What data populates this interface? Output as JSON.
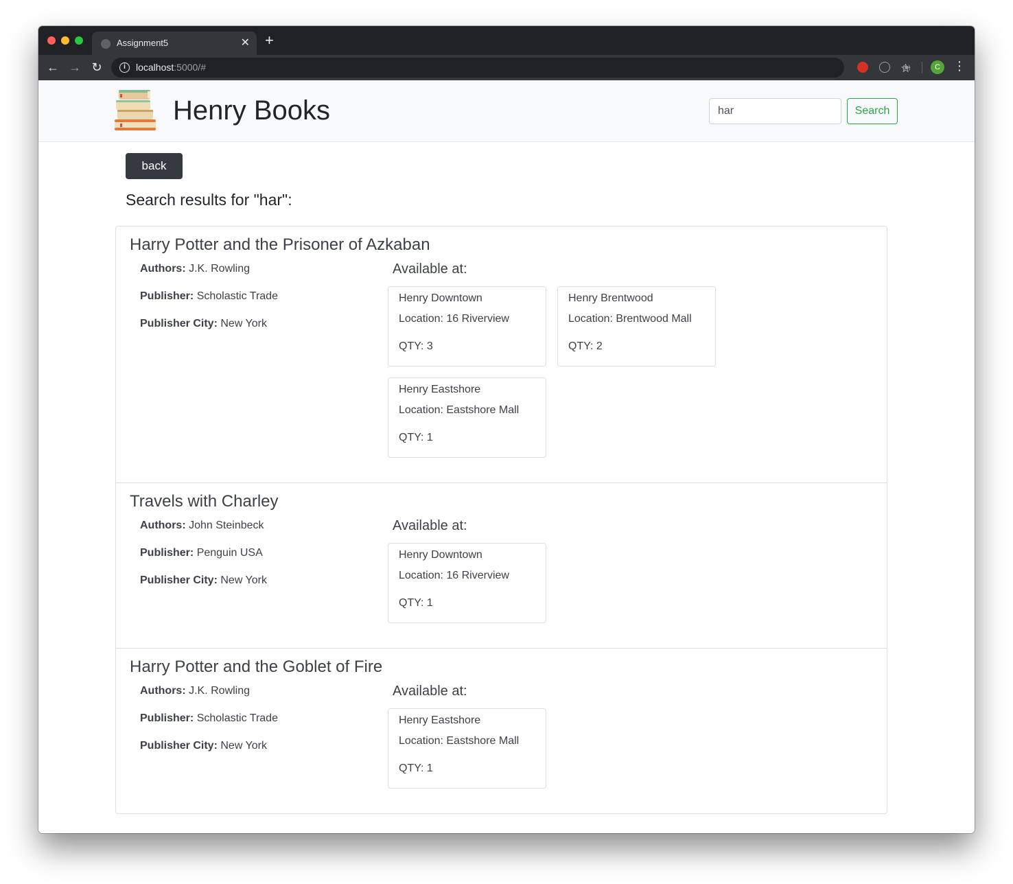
{
  "browser": {
    "tab_title": "Assignment5",
    "url_host": "localhost",
    "url_rest": ":5000/#",
    "profile_initial": "C"
  },
  "navbar": {
    "brand": "Henry Books",
    "search_value": "har",
    "search_button": "Search"
  },
  "back_button": "back",
  "results_heading": "Search results for \"har\":",
  "labels": {
    "authors": "Authors:",
    "publisher": "Publisher:",
    "publisher_city": "Publisher City:",
    "available_at": "Available at:"
  },
  "books": [
    {
      "title": "Harry Potter and the Prisoner of Azkaban",
      "authors": "J.K. Rowling",
      "publisher": "Scholastic Trade",
      "publisher_city": "New York",
      "stores": [
        {
          "name": "Henry Downtown",
          "location": "Location: 16 Riverview",
          "qty": "QTY: 3"
        },
        {
          "name": "Henry Brentwood",
          "location": "Location: Brentwood Mall",
          "qty": "QTY: 2"
        },
        {
          "name": "Henry Eastshore",
          "location": "Location: Eastshore Mall",
          "qty": "QTY: 1"
        }
      ]
    },
    {
      "title": "Travels with Charley",
      "authors": "John Steinbeck",
      "publisher": "Penguin USA",
      "publisher_city": "New York",
      "stores": [
        {
          "name": "Henry Downtown",
          "location": "Location: 16 Riverview",
          "qty": "QTY: 1"
        }
      ]
    },
    {
      "title": "Harry Potter and the Goblet of Fire",
      "authors": "J.K. Rowling",
      "publisher": "Scholastic Trade",
      "publisher_city": "New York",
      "stores": [
        {
          "name": "Henry Eastshore",
          "location": "Location: Eastshore Mall",
          "qty": "QTY: 1"
        }
      ]
    }
  ],
  "colors": {
    "search_green": "#28a745",
    "back_dark": "#343a40",
    "navbar_bg": "#f8f9fa"
  }
}
